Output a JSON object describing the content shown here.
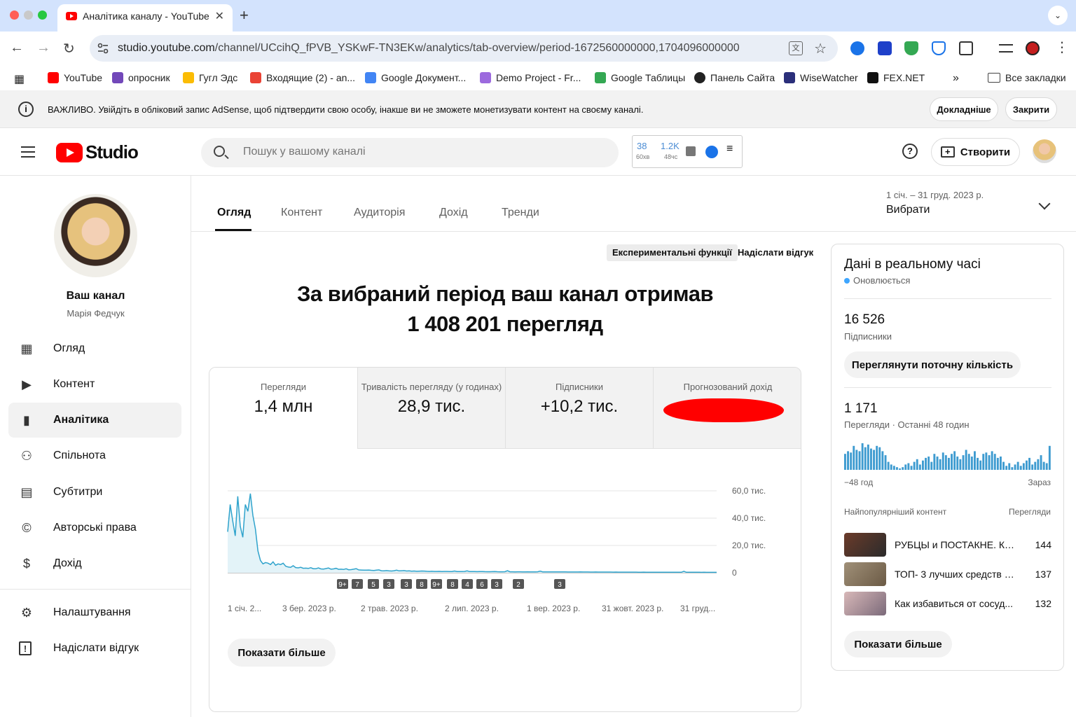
{
  "browser": {
    "tab_title": "Аналітика каналу - YouTube",
    "url_host": "studio.youtube.com",
    "url_path": "/channel/UCcihQ_fPVB_YSKwF-TN3EKw/analytics/tab-overview/period-1672560000000,1704096000000",
    "translate_glyph": "文",
    "bookmarks": [
      {
        "label": "YouTube",
        "color": "#ff0000"
      },
      {
        "label": "опросник",
        "color": "#7248b9"
      },
      {
        "label": "Гугл Эдс",
        "color": "#fbbc04"
      },
      {
        "label": "Входящие (2) - an...",
        "color": "#ea4335"
      },
      {
        "label": "Google Документ...",
        "color": "#4285f4"
      },
      {
        "label": "Demo Project - Fr...",
        "color": "#9c6ade"
      },
      {
        "label": "Google Таблицы",
        "color": "#34a853"
      },
      {
        "label": "Панель Сайта",
        "color": "#222222"
      },
      {
        "label": "WiseWatcher",
        "color": "#2b2f7a"
      },
      {
        "label": "FEX.NET",
        "color": "#111111"
      }
    ],
    "more_bookmarks": "»",
    "all_bookmarks": "Все закладки"
  },
  "notice": {
    "message": "ВАЖЛИВО. Увійдіть в обліковий запис AdSense, щоб підтвердити свою особу, інакше ви не зможете монетизувати контент на своєму каналі.",
    "more_label": "Докладніше",
    "close_label": "Закрити"
  },
  "header": {
    "logo_text": "Studio",
    "search_placeholder": "Пошук у вашому каналі",
    "stats": {
      "a": "38",
      "a_sub": "60хв",
      "b": "1.2K",
      "b_sub": "48чс"
    },
    "help": "?",
    "create_label": "Створити"
  },
  "sidebar": {
    "channel_title": "Ваш канал",
    "channel_owner": "Марія Федчук",
    "items": [
      {
        "label": "Огляд",
        "icon": "dashboard-icon",
        "glyph": "▦"
      },
      {
        "label": "Контент",
        "icon": "content-icon",
        "glyph": "▶"
      },
      {
        "label": "Аналітика",
        "icon": "analytics-icon",
        "glyph": "▮"
      },
      {
        "label": "Спільнота",
        "icon": "community-icon",
        "glyph": "⚇"
      },
      {
        "label": "Субтитри",
        "icon": "subtitles-icon",
        "glyph": "▤"
      },
      {
        "label": "Авторські права",
        "icon": "copyright-icon",
        "glyph": "©"
      },
      {
        "label": "Дохід",
        "icon": "monetization-icon",
        "glyph": "$"
      }
    ],
    "bottom_items": [
      {
        "label": "Налаштування",
        "icon": "settings-icon",
        "glyph": "⚙"
      },
      {
        "label": "Надіслати відгук",
        "icon": "feedback-icon",
        "glyph": "!"
      }
    ]
  },
  "tabs": [
    "Огляд",
    "Контент",
    "Аудиторія",
    "Дохід",
    "Тренди"
  ],
  "period": {
    "range": "1 січ. – 31 груд. 2023 р.",
    "label": "Вибрати"
  },
  "main": {
    "experimental": "Експериментальні функції",
    "feedback": "Надіслати відгук",
    "headline_1": "За вибраний період ваш канал отримав",
    "headline_2": "1 408 201 перегляд",
    "metrics": [
      {
        "label": "Перегляди",
        "value": "1,4 млн"
      },
      {
        "label": "Тривалість перегляду (у годинах)",
        "value": "28,9 тис."
      },
      {
        "label": "Підписники",
        "value": "+10,2 тис."
      },
      {
        "label": "Прогнозований дохід",
        "value": ""
      }
    ],
    "show_more": "Показати більше"
  },
  "chart_data": {
    "type": "area",
    "series": [
      {
        "values": [
          30000,
          50000,
          38000,
          27000,
          56000,
          34000,
          26000,
          50000,
          45000,
          58000,
          42000,
          32000,
          16000,
          9000,
          6500,
          7500,
          7000,
          6000,
          8000,
          5500,
          6500,
          6000,
          7000,
          4800,
          4200,
          4000,
          5200,
          3800,
          3600,
          4000,
          3300,
          3400,
          3200,
          3700,
          3000,
          2900,
          3600,
          2800,
          2700,
          3100,
          3500,
          2600,
          2800,
          3300,
          2500,
          2600,
          2400,
          2900,
          2200,
          2300,
          2600,
          3000,
          2100,
          2000,
          1900,
          1900,
          2000,
          1800,
          1700,
          1900,
          2100,
          1500,
          1400,
          1600,
          1400,
          1300,
          1500,
          1900,
          1400,
          1500,
          1600,
          1300,
          1400,
          1200,
          1300,
          1100,
          1200,
          1300,
          1250,
          1100,
          1000,
          1100,
          950,
          1000,
          1050,
          900,
          950,
          1000,
          880,
          900,
          1300,
          900,
          850,
          900,
          950,
          1400,
          880,
          850,
          850,
          800,
          850,
          900,
          820,
          780,
          750,
          800,
          850,
          760,
          700,
          720,
          750,
          1500,
          720,
          700,
          680,
          700,
          710,
          690,
          650,
          700,
          640,
          650,
          620,
          700,
          1200,
          660,
          640,
          600,
          620,
          650,
          610,
          600,
          590,
          600,
          620,
          580,
          570,
          580,
          560,
          570,
          590,
          540,
          550,
          560,
          520,
          530,
          540,
          510,
          500,
          520,
          510,
          500,
          490,
          480,
          500,
          480,
          470,
          460,
          480,
          470,
          460,
          450,
          440,
          430,
          420,
          440,
          430,
          420,
          410,
          420,
          400,
          410,
          400,
          390,
          380,
          390,
          380,
          370,
          380,
          360,
          370,
          1100,
          380,
          370,
          360,
          350,
          360,
          340,
          330,
          340,
          320,
          310,
          320,
          310,
          300
        ]
      }
    ],
    "y_ticks": [
      "60,0 тис.",
      "40,0 тис.",
      "20,0 тис.",
      "0"
    ],
    "ylim": [
      0,
      60000
    ],
    "x_ticks": [
      "1 січ. 2...",
      "3 бер. 2023 р.",
      "2 трав. 2023 р.",
      "2 лип. 2023 р.",
      "1 вер. 2023 р.",
      "31 жовт. 2023 р.",
      "31 груд..."
    ],
    "markers": [
      "9+",
      "7",
      "5",
      "3",
      "3",
      "8",
      "9+",
      "8",
      "4",
      "6",
      "3",
      "2",
      "3"
    ],
    "grid": true,
    "color": "#2fa3cc"
  },
  "realtime": {
    "title": "Дані в реальному часі",
    "updating": "Оновлюється",
    "subscribers": "16 526",
    "subscribers_label": "Підписники",
    "view_count_btn": "Переглянути поточну кількість",
    "views": "1 171",
    "views_label": "Перегляди · Останні 48 годин",
    "bars": [
      0.6,
      0.7,
      0.65,
      0.9,
      0.75,
      0.7,
      1.0,
      0.85,
      0.95,
      0.8,
      0.75,
      0.9,
      0.85,
      0.7,
      0.55,
      0.3,
      0.2,
      0.15,
      0.1,
      0.05,
      0.1,
      0.2,
      0.25,
      0.15,
      0.3,
      0.4,
      0.2,
      0.35,
      0.45,
      0.5,
      0.3,
      0.6,
      0.5,
      0.4,
      0.65,
      0.55,
      0.45,
      0.6,
      0.7,
      0.5,
      0.4,
      0.55,
      0.75,
      0.6,
      0.5,
      0.7,
      0.45,
      0.35,
      0.6,
      0.65,
      0.55,
      0.7,
      0.6,
      0.45,
      0.5,
      0.3,
      0.15,
      0.25,
      0.1,
      0.2,
      0.3,
      0.15,
      0.25,
      0.35,
      0.45,
      0.2,
      0.3,
      0.4,
      0.55,
      0.3,
      0.25,
      0.9
    ],
    "axis_start": "−48 год",
    "axis_end": "Зараз",
    "top_content_label": "Найпопулярніший контент",
    "top_views_label": "Перегляди",
    "top": [
      {
        "title": "РУБЦЫ и ПОСТАКНЕ. Ка...",
        "views": "144",
        "color": "#6b3b2a"
      },
      {
        "title": "ТОП- 3 лучших средств о...",
        "views": "137",
        "color": "#a09078"
      },
      {
        "title": "Как избавиться от сосуд...",
        "views": "132",
        "color": "#d8b8b8"
      }
    ],
    "show_more": "Показати більше"
  }
}
